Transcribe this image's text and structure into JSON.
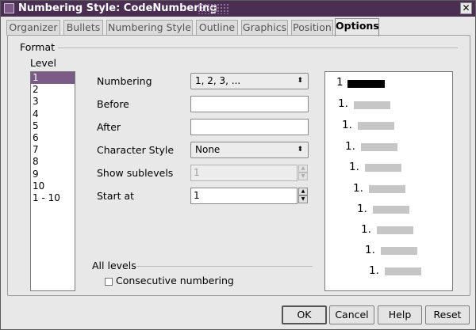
{
  "window": {
    "title": "Numbering Style: CodeNumbering",
    "close_glyph": "✕"
  },
  "tabs": [
    {
      "label": "Organizer"
    },
    {
      "label": "Bullets"
    },
    {
      "label": "Numbering Style"
    },
    {
      "label": "Outline"
    },
    {
      "label": "Graphics"
    },
    {
      "label": "Position"
    },
    {
      "label": "Options",
      "active": true
    }
  ],
  "format": {
    "title": "Format",
    "level_label": "Level",
    "levels": [
      "1",
      "2",
      "3",
      "4",
      "5",
      "6",
      "7",
      "8",
      "9",
      "10",
      "1 - 10"
    ],
    "selected_level": "1"
  },
  "fields": {
    "numbering": {
      "label": "Numbering",
      "value": "1, 2, 3, ..."
    },
    "before": {
      "label": "Before",
      "value": ""
    },
    "after": {
      "label": "After",
      "value": ""
    },
    "character_style": {
      "label": "Character Style",
      "value": "None"
    },
    "show_sublevels": {
      "label": "Show sublevels",
      "value": "1"
    },
    "start_at": {
      "label": "Start at",
      "value": "1"
    }
  },
  "all_levels": {
    "title": "All levels",
    "consecutive_label": "Consecutive numbering",
    "consecutive_checked": false
  },
  "preview": {
    "numbers": [
      "1",
      "1.",
      "1.",
      "1.",
      "1.",
      "1.",
      "1.",
      "1.",
      "1.",
      "1."
    ]
  },
  "buttons": {
    "ok": "OK",
    "cancel": "Cancel",
    "help": "Help",
    "reset": "Reset"
  },
  "icons": {
    "dropdown_arrow": "⬍",
    "spin_up": "▲",
    "spin_down": "▼"
  },
  "colors": {
    "titlebar": "#4a2f53",
    "selection": "#7b5c86",
    "preview_bar": "#c6c6c6"
  }
}
